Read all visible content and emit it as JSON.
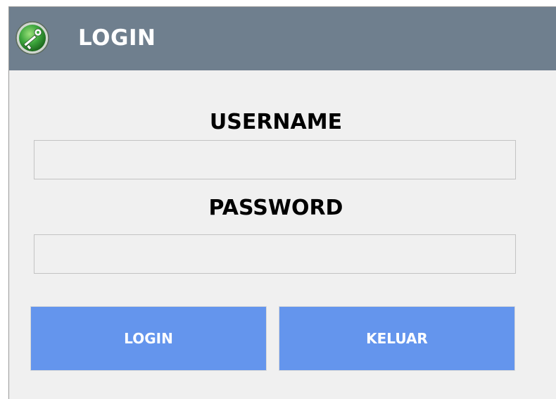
{
  "window": {
    "title": "LOGIN",
    "title_icon": "key-icon"
  },
  "form": {
    "username_label": "USERNAME",
    "username_value": "",
    "password_label": "PASSWORD",
    "password_value": ""
  },
  "buttons": {
    "login_label": "LOGIN",
    "keluar_label": "KELUAR"
  },
  "colors": {
    "titlebar": "#6f7f8e",
    "button": "#6495ed",
    "background": "#f0f0f0",
    "icon_green": "#3da63d"
  }
}
